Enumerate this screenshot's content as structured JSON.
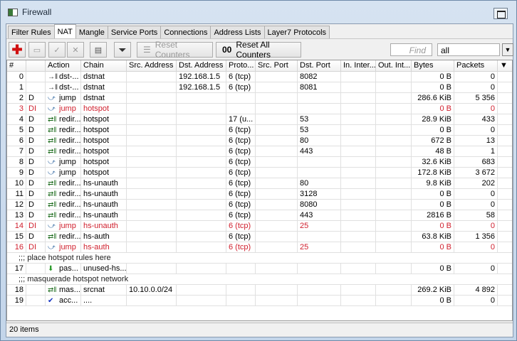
{
  "window": {
    "title": "Firewall"
  },
  "tabs": [
    "Filter Rules",
    "NAT",
    "Mangle",
    "Service Ports",
    "Connections",
    "Address Lists",
    "Layer7 Protocols"
  ],
  "active_tab": "NAT",
  "toolbar": {
    "reset_counters": "Reset Counters",
    "reset_all_counters": "Reset All Counters",
    "reset_all_prefix": "00",
    "find_placeholder": "Find",
    "filter_value": "all"
  },
  "columns": [
    "#",
    "",
    "Action",
    "Chain",
    "Src. Address",
    "Dst. Address",
    "Proto...",
    "Src. Port",
    "Dst. Port",
    "In. Inter...",
    "Out. Int...",
    "Bytes",
    "Packets"
  ],
  "rows": [
    {
      "num": "0",
      "flags": "",
      "icon": "dst-nat",
      "action": "dst-...",
      "chain": "dstnat",
      "src": "",
      "dst": "192.168.1.5",
      "proto": "6 (tcp)",
      "sport": "",
      "dport": "8082",
      "bytes": "0 B",
      "packets": "0"
    },
    {
      "num": "1",
      "flags": "",
      "icon": "dst-nat",
      "action": "dst-...",
      "chain": "dstnat",
      "src": "",
      "dst": "192.168.1.5",
      "proto": "6 (tcp)",
      "sport": "",
      "dport": "8081",
      "bytes": "0 B",
      "packets": "0"
    },
    {
      "num": "2",
      "flags": "D",
      "icon": "jump",
      "action": "jump",
      "chain": "dstnat",
      "src": "",
      "dst": "",
      "proto": "",
      "sport": "",
      "dport": "",
      "bytes": "286.6 KiB",
      "packets": "5 356"
    },
    {
      "num": "3",
      "flags": "DI",
      "icon": "jump",
      "action": "jump",
      "chain": "hotspot",
      "src": "",
      "dst": "",
      "proto": "",
      "sport": "",
      "dport": "",
      "bytes": "0 B",
      "packets": "0",
      "disabled": true
    },
    {
      "num": "4",
      "flags": "D",
      "icon": "redirect",
      "action": "redir...",
      "chain": "hotspot",
      "src": "",
      "dst": "",
      "proto": "17 (u...",
      "sport": "",
      "dport": "53",
      "bytes": "28.9 KiB",
      "packets": "433"
    },
    {
      "num": "5",
      "flags": "D",
      "icon": "redirect",
      "action": "redir...",
      "chain": "hotspot",
      "src": "",
      "dst": "",
      "proto": "6 (tcp)",
      "sport": "",
      "dport": "53",
      "bytes": "0 B",
      "packets": "0"
    },
    {
      "num": "6",
      "flags": "D",
      "icon": "redirect",
      "action": "redir...",
      "chain": "hotspot",
      "src": "",
      "dst": "",
      "proto": "6 (tcp)",
      "sport": "",
      "dport": "80",
      "bytes": "672 B",
      "packets": "13"
    },
    {
      "num": "7",
      "flags": "D",
      "icon": "redirect",
      "action": "redir...",
      "chain": "hotspot",
      "src": "",
      "dst": "",
      "proto": "6 (tcp)",
      "sport": "",
      "dport": "443",
      "bytes": "48 B",
      "packets": "1"
    },
    {
      "num": "8",
      "flags": "D",
      "icon": "jump",
      "action": "jump",
      "chain": "hotspot",
      "src": "",
      "dst": "",
      "proto": "6 (tcp)",
      "sport": "",
      "dport": "",
      "bytes": "32.6 KiB",
      "packets": "683"
    },
    {
      "num": "9",
      "flags": "D",
      "icon": "jump",
      "action": "jump",
      "chain": "hotspot",
      "src": "",
      "dst": "",
      "proto": "6 (tcp)",
      "sport": "",
      "dport": "",
      "bytes": "172.8 KiB",
      "packets": "3 672"
    },
    {
      "num": "10",
      "flags": "D",
      "icon": "redirect",
      "action": "redir...",
      "chain": "hs-unauth",
      "src": "",
      "dst": "",
      "proto": "6 (tcp)",
      "sport": "",
      "dport": "80",
      "bytes": "9.8 KiB",
      "packets": "202"
    },
    {
      "num": "11",
      "flags": "D",
      "icon": "redirect",
      "action": "redir...",
      "chain": "hs-unauth",
      "src": "",
      "dst": "",
      "proto": "6 (tcp)",
      "sport": "",
      "dport": "3128",
      "bytes": "0 B",
      "packets": "0"
    },
    {
      "num": "12",
      "flags": "D",
      "icon": "redirect",
      "action": "redir...",
      "chain": "hs-unauth",
      "src": "",
      "dst": "",
      "proto": "6 (tcp)",
      "sport": "",
      "dport": "8080",
      "bytes": "0 B",
      "packets": "0"
    },
    {
      "num": "13",
      "flags": "D",
      "icon": "redirect",
      "action": "redir...",
      "chain": "hs-unauth",
      "src": "",
      "dst": "",
      "proto": "6 (tcp)",
      "sport": "",
      "dport": "443",
      "bytes": "2816 B",
      "packets": "58"
    },
    {
      "num": "14",
      "flags": "DI",
      "icon": "jump",
      "action": "jump",
      "chain": "hs-unauth",
      "src": "",
      "dst": "",
      "proto": "6 (tcp)",
      "sport": "",
      "dport": "25",
      "bytes": "0 B",
      "packets": "0",
      "disabled": true
    },
    {
      "num": "15",
      "flags": "D",
      "icon": "redirect",
      "action": "redir...",
      "chain": "hs-auth",
      "src": "",
      "dst": "",
      "proto": "6 (tcp)",
      "sport": "",
      "dport": "",
      "bytes": "63.8 KiB",
      "packets": "1 356"
    },
    {
      "num": "16",
      "flags": "DI",
      "icon": "jump",
      "action": "jump",
      "chain": "hs-auth",
      "src": "",
      "dst": "",
      "proto": "6 (tcp)",
      "sport": "",
      "dport": "25",
      "bytes": "0 B",
      "packets": "0",
      "disabled": true
    },
    {
      "comment": ";;; place hotspot rules here"
    },
    {
      "num": "17",
      "flags": "",
      "icon": "passthrough",
      "action": "pas...",
      "chain": "unused-hs...",
      "src": "",
      "dst": "",
      "proto": "",
      "sport": "",
      "dport": "",
      "bytes": "0 B",
      "packets": "0"
    },
    {
      "comment": ";;; masquerade hotspot network"
    },
    {
      "num": "18",
      "flags": "",
      "icon": "redirect",
      "action": "mas...",
      "chain": "srcnat",
      "src": "10.10.0.0/24",
      "dst": "",
      "proto": "",
      "sport": "",
      "dport": "",
      "bytes": "269.2 KiB",
      "packets": "4 892"
    },
    {
      "num": "19",
      "flags": "",
      "icon": "accept",
      "action": "acc...",
      "chain": "....",
      "src": "",
      "dst": "",
      "proto": "",
      "sport": "",
      "dport": "",
      "bytes": "0 B",
      "packets": "0"
    }
  ],
  "status": {
    "items": "20 items"
  },
  "colors": {
    "disabled": "#d0202e",
    "add": "#d01010",
    "selected_tab_bg": "#ffffff"
  }
}
